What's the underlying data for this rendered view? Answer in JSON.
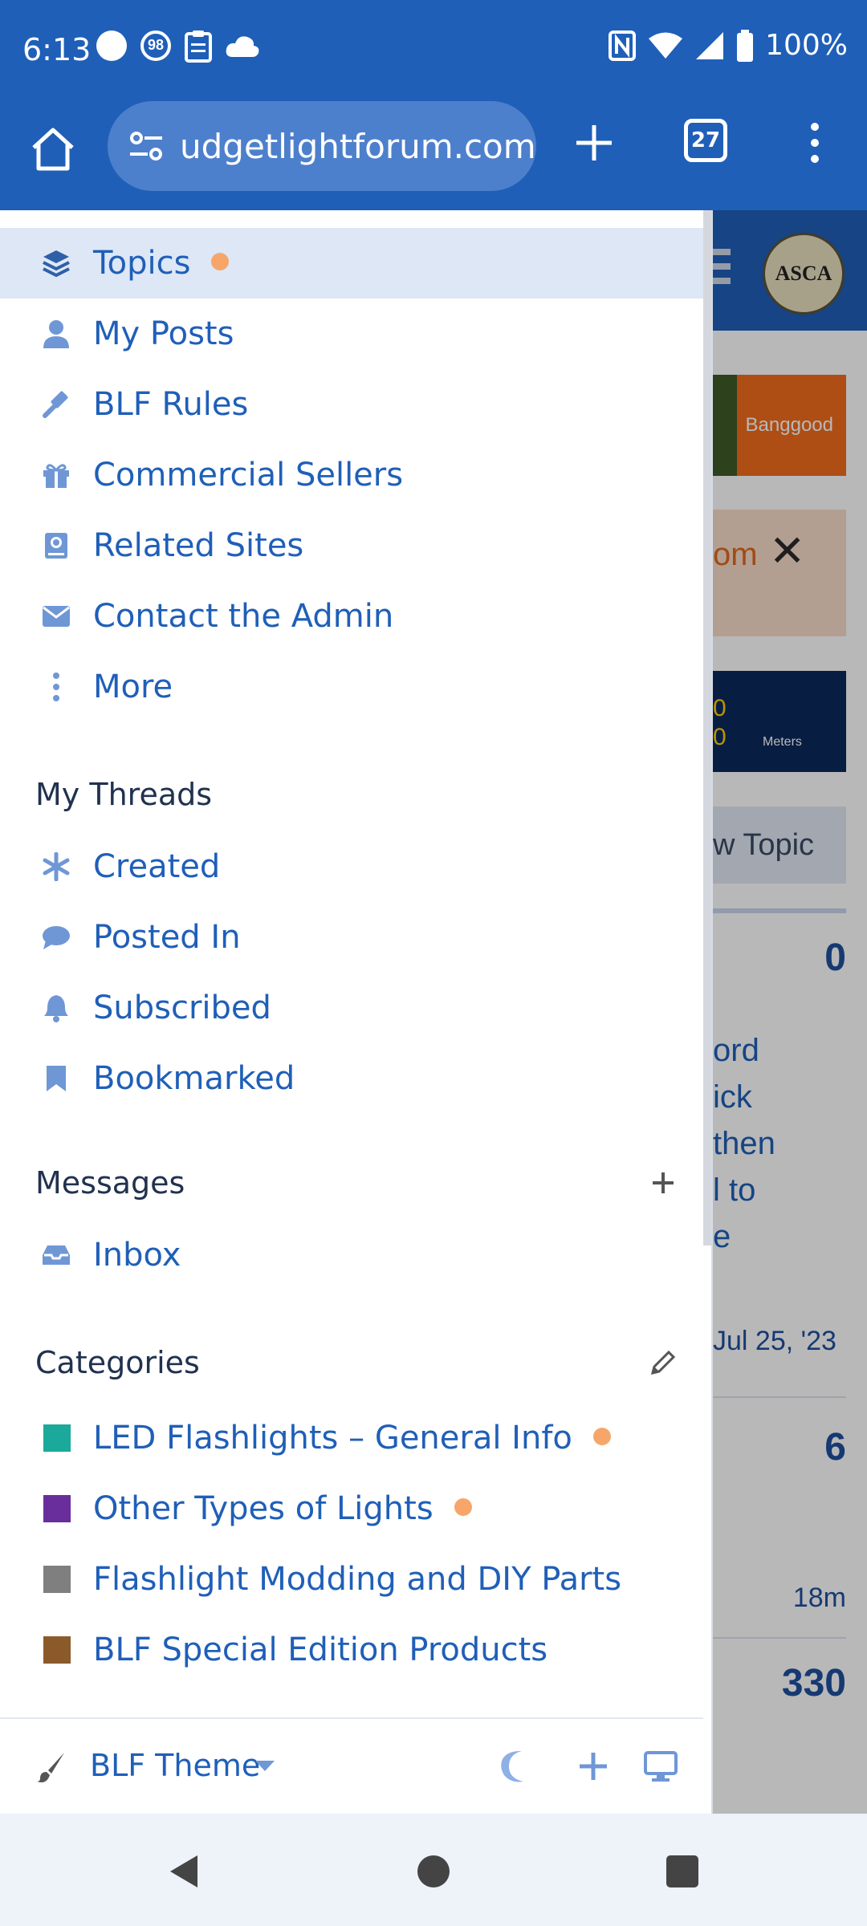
{
  "status_bar": {
    "time": "6:13",
    "badge_count": "98",
    "battery": "100%"
  },
  "browser": {
    "url": "udgetlightforum.com",
    "tab_count": "27"
  },
  "background_page": {
    "logo_text": "ASCA",
    "ad_banggood": "Banggood",
    "ad_partial": "om",
    "ad_space_line1": "0",
    "ad_space_line2": "0",
    "ad_space_small": "Meters",
    "new_topic": "w Topic",
    "count1": "0",
    "text_lines": [
      "ord",
      "ick",
      "then",
      "l to",
      "e"
    ],
    "date": "Jul 25, '23",
    "count2": "6",
    "time_ago": "18m",
    "count3": "330"
  },
  "drawer": {
    "nav": [
      {
        "label": "Topics",
        "icon": "layers-icon"
      },
      {
        "label": "My Posts",
        "icon": "user-icon"
      },
      {
        "label": "BLF Rules",
        "icon": "gavel-icon"
      },
      {
        "label": "Commercial Sellers",
        "icon": "gift-icon"
      },
      {
        "label": "Related Sites",
        "icon": "book-icon"
      },
      {
        "label": "Contact the Admin",
        "icon": "envelope-icon"
      },
      {
        "label": "More",
        "icon": "vertical-dots-icon"
      }
    ],
    "my_threads": {
      "title": "My Threads",
      "items": [
        {
          "label": "Created",
          "icon": "asterisk-icon"
        },
        {
          "label": "Posted In",
          "icon": "speech-bubble-icon"
        },
        {
          "label": "Subscribed",
          "icon": "bell-icon"
        },
        {
          "label": "Bookmarked",
          "icon": "bookmark-icon"
        }
      ]
    },
    "messages": {
      "title": "Messages",
      "items": [
        {
          "label": "Inbox",
          "icon": "inbox-icon"
        }
      ]
    },
    "categories": {
      "title": "Categories",
      "items": [
        {
          "label": "LED Flashlights – General Info",
          "color": "#1aa99a",
          "unread": true
        },
        {
          "label": "Other Types of Lights",
          "color": "#6a2e9c",
          "unread": true
        },
        {
          "label": "Flashlight Modding and DIY Parts",
          "color": "#7f7f7f",
          "unread": false
        },
        {
          "label": "BLF Special Edition Products",
          "color": "#8b5a2b",
          "unread": false
        }
      ]
    },
    "footer": {
      "theme_label": "BLF Theme"
    }
  },
  "colors": {
    "accent": "#1f5fb8",
    "unread_dot": "#f7a66a",
    "icon": "#6f97d6"
  }
}
